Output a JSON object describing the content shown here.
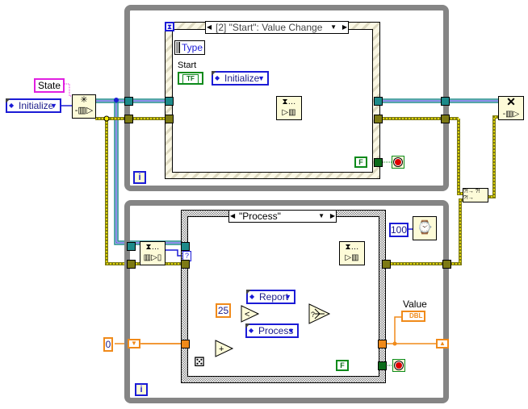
{
  "diagram": {
    "type": "LabVIEW block diagram — producer/consumer queued state machine",
    "colors": {
      "loop_border": "#858585",
      "enum_wire": "#1b1bd6",
      "queue_wire": "#1d8a8a",
      "error_wire": "#7d7a14",
      "numeric_wire": "#f08a1a",
      "boolean_wire": "#0b8a1a",
      "label_border": "#e020e0"
    },
    "producer": {
      "state_label": "State",
      "init_enum_value": "Initialize",
      "obtain_queue_icon": "obtain-queue",
      "event_structure": {
        "case_selector": "[2] \"Start\": Value Change",
        "event_data_node": "Type",
        "control_label": "Start",
        "control_glyph": "TF",
        "enum_value": "Initialize",
        "enqueue_icon": "enqueue-element",
        "bool_const": "F"
      }
    },
    "consumer": {
      "dequeue_icon": "dequeue-element",
      "case_selector": "\"Process\"",
      "timeout_unknown": "?",
      "wait_ms": "100",
      "shift_init": "0",
      "compare_const": "25",
      "enum_report": "Report",
      "enum_process": "Process",
      "indicator_label": "Value",
      "indicator_type": "DBL",
      "bool_const": "F"
    },
    "cleanup": {
      "release_queue_icon": "release-queue",
      "merge_errors_icon": "merge-errors"
    }
  }
}
